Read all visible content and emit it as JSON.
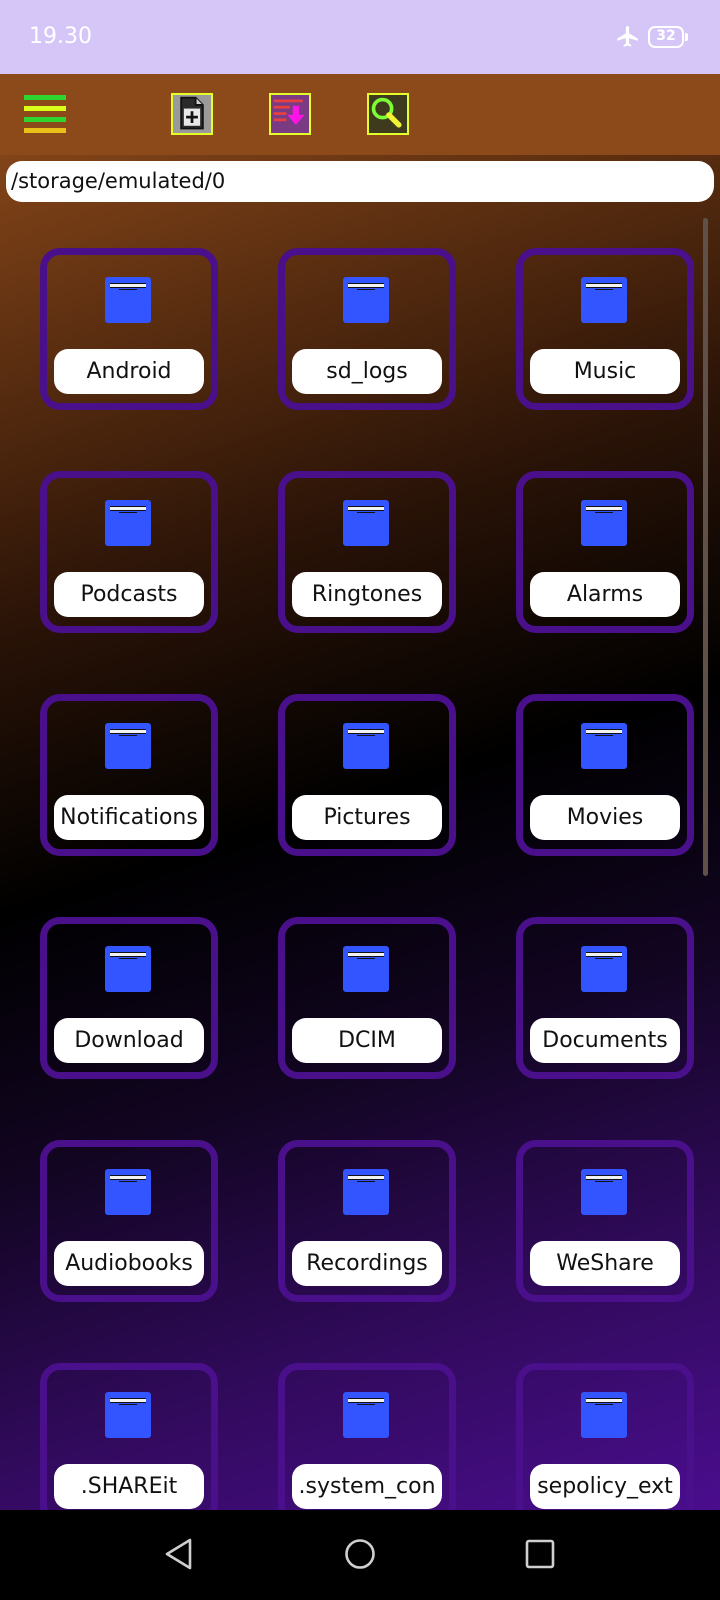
{
  "status_bar": {
    "time": "19.30",
    "battery": "32"
  },
  "toolbar": {
    "menu_icon": "hamburger-menu-icon",
    "buttons": [
      {
        "name": "new-file-button",
        "icon": "new-file-icon"
      },
      {
        "name": "download-button",
        "icon": "download-icon"
      },
      {
        "name": "search-button",
        "icon": "search-icon"
      }
    ],
    "menu_colors": [
      "#2ed62e",
      "#d9ff1a",
      "#2ed62e",
      "#e8c018"
    ]
  },
  "path": "/storage/emulated/0",
  "folders": [
    {
      "label": "Android"
    },
    {
      "label": "sd_logs"
    },
    {
      "label": "Music"
    },
    {
      "label": "Podcasts"
    },
    {
      "label": "Ringtones"
    },
    {
      "label": "Alarms"
    },
    {
      "label": "Notifications"
    },
    {
      "label": "Pictures"
    },
    {
      "label": "Movies"
    },
    {
      "label": "Download"
    },
    {
      "label": "DCIM"
    },
    {
      "label": "Documents"
    },
    {
      "label": "Audiobooks"
    },
    {
      "label": "Recordings"
    },
    {
      "label": "WeShare"
    },
    {
      "label": ".SHAREit"
    },
    {
      "label": ".system_con"
    },
    {
      "label": "sepolicy_ext"
    }
  ],
  "colors": {
    "status_bar": "#d6c6f8",
    "toolbar": "#8c4a1b",
    "folder_border": "#4a0f8a",
    "folder_icon": "#3355ff",
    "toolbar_button_border": "#e4ff2a"
  },
  "nav": {
    "back_icon": "back-icon",
    "home_icon": "home-icon",
    "recents_icon": "recents-icon"
  }
}
